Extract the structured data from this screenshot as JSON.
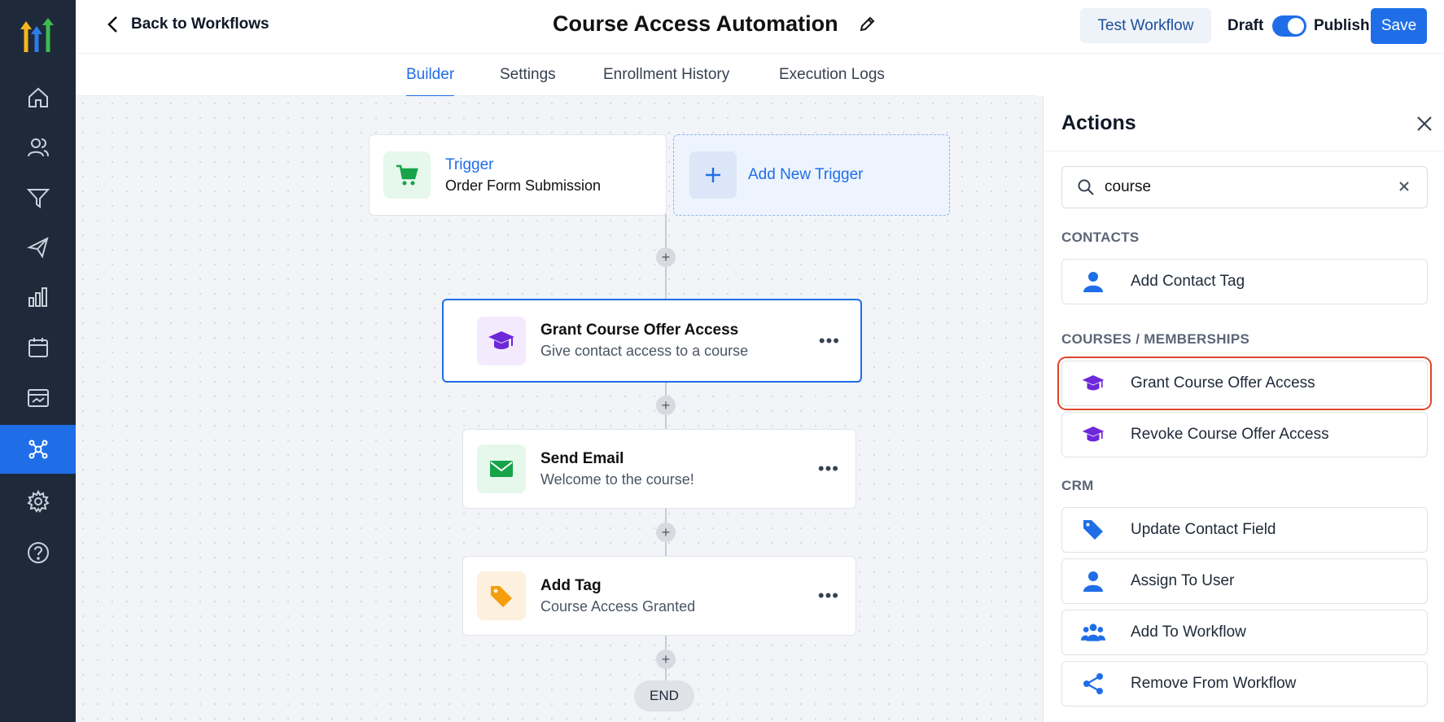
{
  "header": {
    "back_label": "Back to Workflows",
    "title": "Course Access Automation",
    "test_label": "Test Workflow",
    "draft_label": "Draft",
    "publish_label": "Publish",
    "save_label": "Save",
    "publish_toggle_on": true
  },
  "tabs": [
    {
      "label": "Builder",
      "active": true
    },
    {
      "label": "Settings",
      "active": false
    },
    {
      "label": "Enrollment History",
      "active": false
    },
    {
      "label": "Execution Logs",
      "active": false
    }
  ],
  "sidebar": {
    "items": [
      "home-icon",
      "contacts-icon",
      "funnel-icon",
      "megaphone-icon",
      "reports-icon",
      "calendar-icon",
      "payments-icon",
      "automation-icon",
      "settings-icon",
      "help-icon"
    ],
    "active": "automation-icon"
  },
  "canvas": {
    "trigger": {
      "title": "Trigger",
      "subtitle": "Order Form Submission"
    },
    "add_trigger_label": "Add New Trigger",
    "steps": [
      {
        "title": "Grant Course Offer Access",
        "subtitle": "Give contact access to a course",
        "selected": true
      },
      {
        "title": "Send Email",
        "subtitle": "Welcome to the course!"
      },
      {
        "title": "Add Tag",
        "subtitle": "Course Access Granted"
      }
    ],
    "end_label": "END"
  },
  "panel": {
    "title": "Actions",
    "search_value": "course",
    "sections": [
      {
        "name": "CONTACTS",
        "items": [
          {
            "label": "Add Contact Tag",
            "icon": "person-icon"
          }
        ]
      },
      {
        "name": "COURSES / MEMBERSHIPS",
        "items": [
          {
            "label": "Grant Course Offer Access",
            "icon": "graduation-cap-icon",
            "highlighted": true
          },
          {
            "label": "Revoke Course Offer Access",
            "icon": "graduation-cap-icon"
          }
        ]
      },
      {
        "name": "CRM",
        "items": [
          {
            "label": "Update Contact Field",
            "icon": "tag-icon"
          },
          {
            "label": "Assign To User",
            "icon": "person-icon"
          },
          {
            "label": "Add To Workflow",
            "icon": "group-icon"
          },
          {
            "label": "Remove From Workflow",
            "icon": "share-icon"
          }
        ]
      }
    ]
  },
  "colors": {
    "primary": "#1f6ee8",
    "sidebar_bg": "#1e2a3a",
    "highlight_border": "#e0452c",
    "course_icon": "#6d28d9",
    "email_icon": "#16a34a",
    "tag_icon": "#f59e0b"
  }
}
